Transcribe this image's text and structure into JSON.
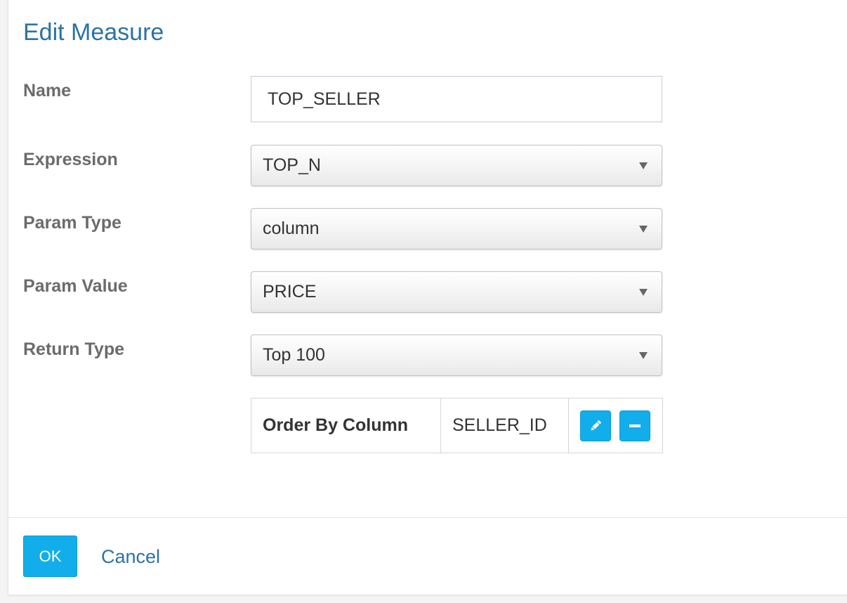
{
  "dialog": {
    "title": "Edit Measure"
  },
  "form": {
    "name": {
      "label": "Name",
      "value": "TOP_SELLER"
    },
    "expression": {
      "label": "Expression",
      "value": "TOP_N"
    },
    "param_type": {
      "label": "Param Type",
      "value": "column"
    },
    "param_value": {
      "label": "Param Value",
      "value": "PRICE"
    },
    "return_type": {
      "label": "Return Type",
      "value": "Top 100"
    }
  },
  "order_by": {
    "header": "Order By Column",
    "value": "SELLER_ID",
    "actions": [
      {
        "icon": "pencil-icon",
        "action": "edit"
      },
      {
        "icon": "minus-icon",
        "action": "remove"
      }
    ]
  },
  "footer": {
    "ok_label": "OK",
    "cancel_label": "Cancel"
  },
  "colors": {
    "accent": "#12aeeb",
    "title": "#2a73a6",
    "label": "#6b6b6b"
  }
}
